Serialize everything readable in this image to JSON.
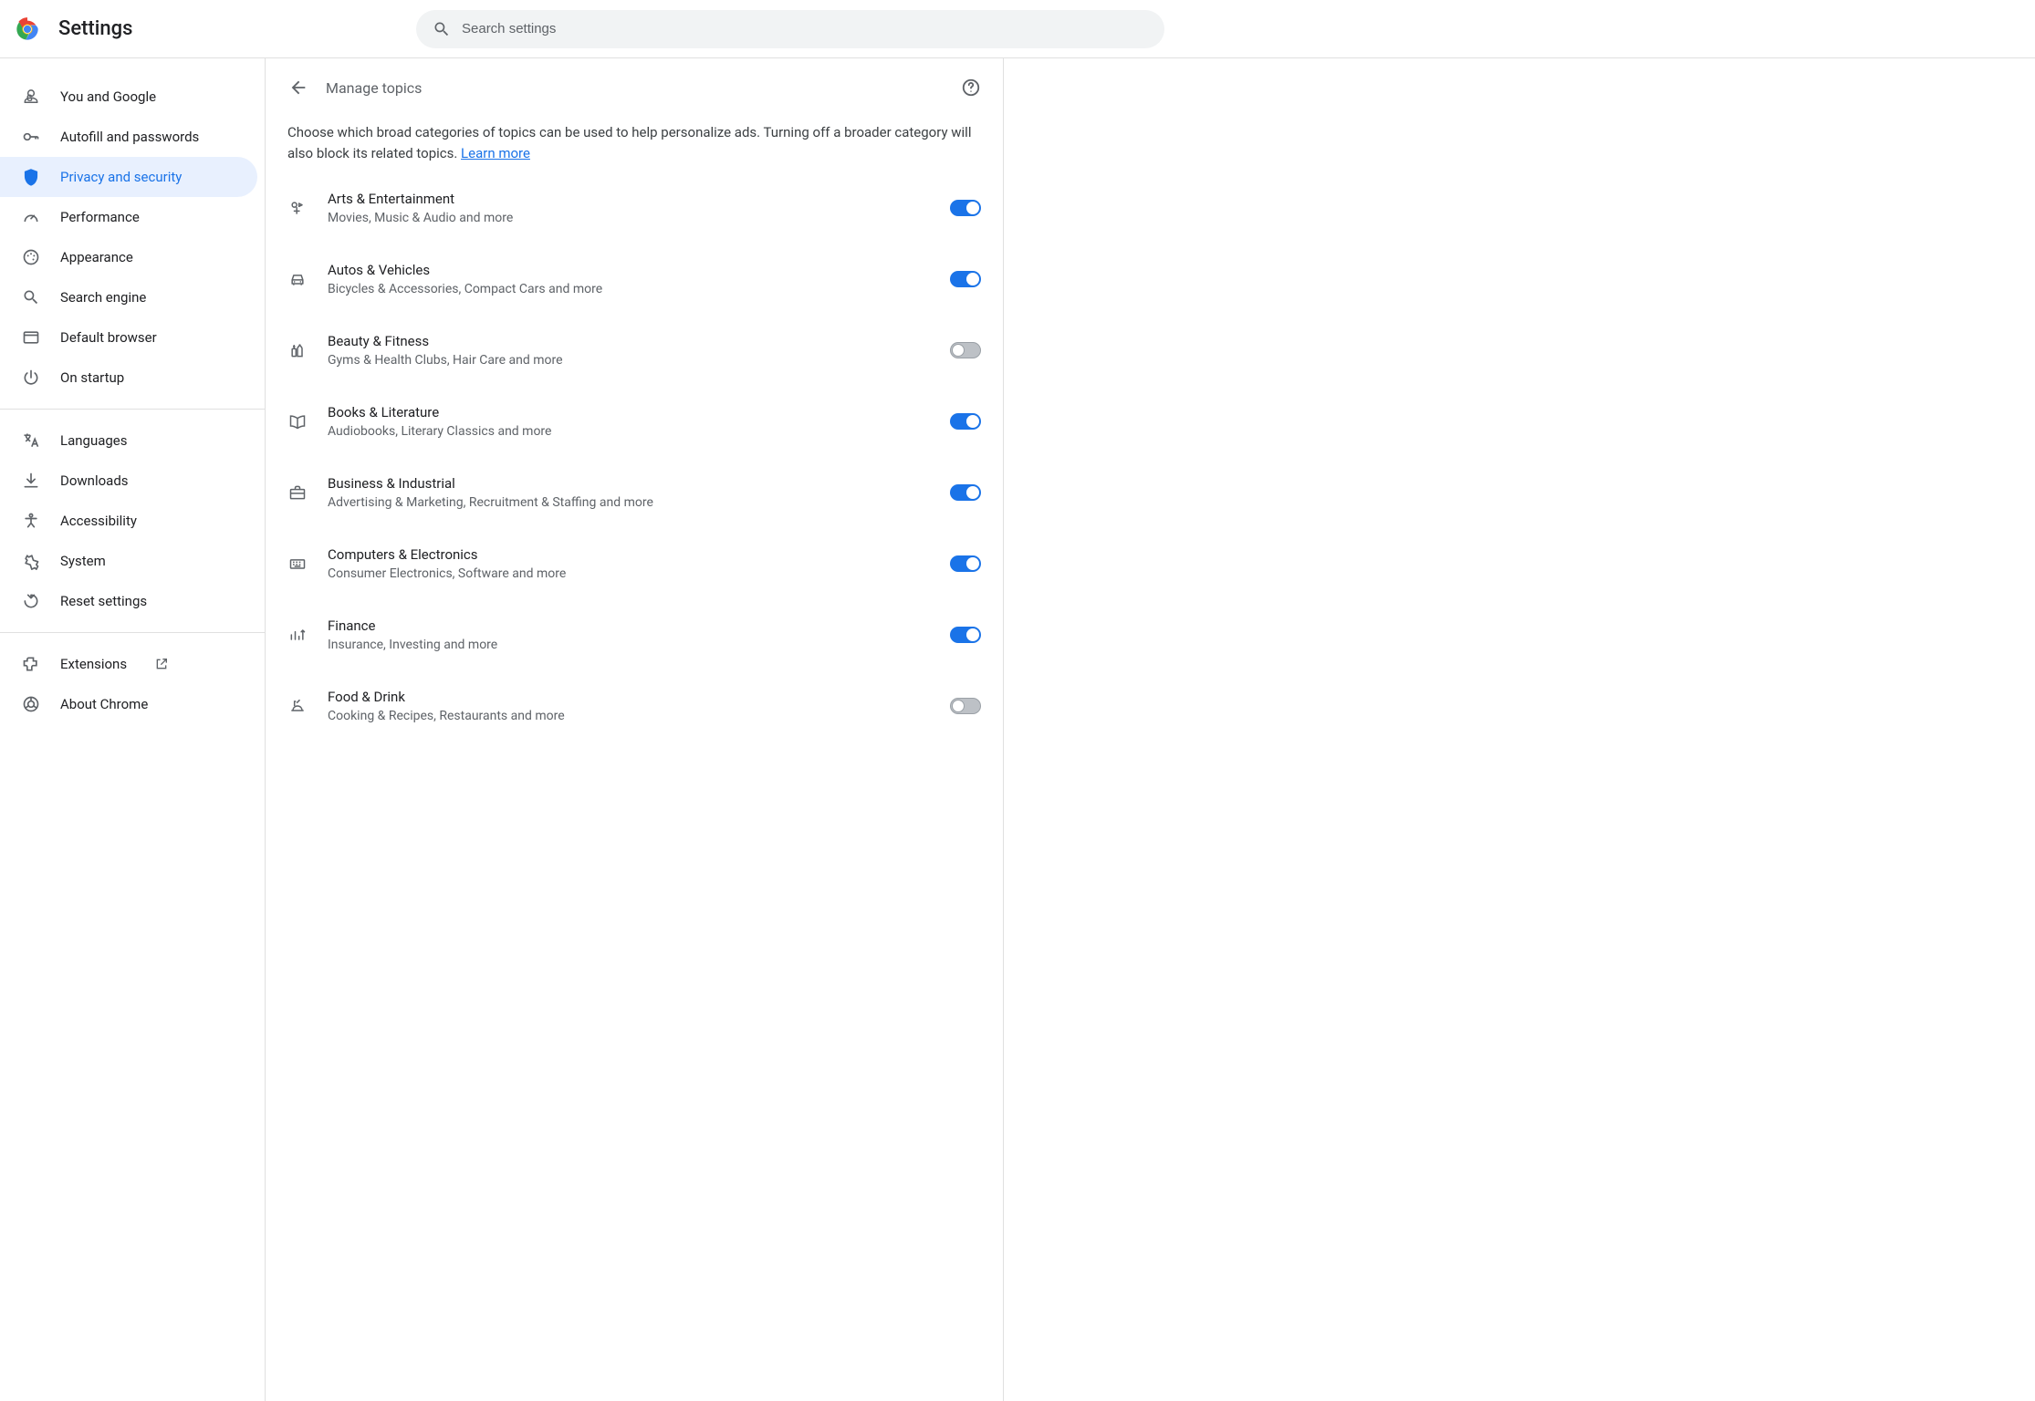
{
  "app": {
    "title": "Settings"
  },
  "search": {
    "placeholder": "Search settings"
  },
  "sidebar": {
    "groups": [
      [
        {
          "id": "you",
          "label": "You and Google"
        },
        {
          "id": "autofill",
          "label": "Autofill and passwords"
        },
        {
          "id": "privacy",
          "label": "Privacy and security",
          "active": true
        },
        {
          "id": "performance",
          "label": "Performance"
        },
        {
          "id": "appearance",
          "label": "Appearance"
        },
        {
          "id": "search-engine",
          "label": "Search engine"
        },
        {
          "id": "default-browser",
          "label": "Default browser"
        },
        {
          "id": "startup",
          "label": "On startup"
        }
      ],
      [
        {
          "id": "languages",
          "label": "Languages"
        },
        {
          "id": "downloads",
          "label": "Downloads"
        },
        {
          "id": "accessibility",
          "label": "Accessibility"
        },
        {
          "id": "system",
          "label": "System"
        },
        {
          "id": "reset",
          "label": "Reset settings"
        }
      ],
      [
        {
          "id": "extensions",
          "label": "Extensions",
          "external": true
        },
        {
          "id": "about",
          "label": "About Chrome"
        }
      ]
    ]
  },
  "page": {
    "title": "Manage topics",
    "description_prefix": "Choose which broad categories of topics can be used to help personalize ads. Turning off a broader category will also block its related topics. ",
    "learn_more": "Learn more"
  },
  "topics": [
    {
      "id": "arts",
      "title": "Arts & Entertainment",
      "subtitle": "Movies, Music & Audio and more",
      "on": true
    },
    {
      "id": "autos",
      "title": "Autos & Vehicles",
      "subtitle": "Bicycles & Accessories, Compact Cars and more",
      "on": true
    },
    {
      "id": "beauty",
      "title": "Beauty & Fitness",
      "subtitle": "Gyms & Health Clubs, Hair Care and more",
      "on": false
    },
    {
      "id": "books",
      "title": "Books & Literature",
      "subtitle": "Audiobooks, Literary Classics and more",
      "on": true
    },
    {
      "id": "business",
      "title": "Business & Industrial",
      "subtitle": "Advertising & Marketing, Recruitment & Staffing and more",
      "on": true
    },
    {
      "id": "computers",
      "title": "Computers & Electronics",
      "subtitle": "Consumer Electronics, Software and more",
      "on": true
    },
    {
      "id": "finance",
      "title": "Finance",
      "subtitle": "Insurance, Investing and more",
      "on": true
    },
    {
      "id": "food",
      "title": "Food & Drink",
      "subtitle": "Cooking & Recipes, Restaurants and more",
      "on": false
    }
  ]
}
